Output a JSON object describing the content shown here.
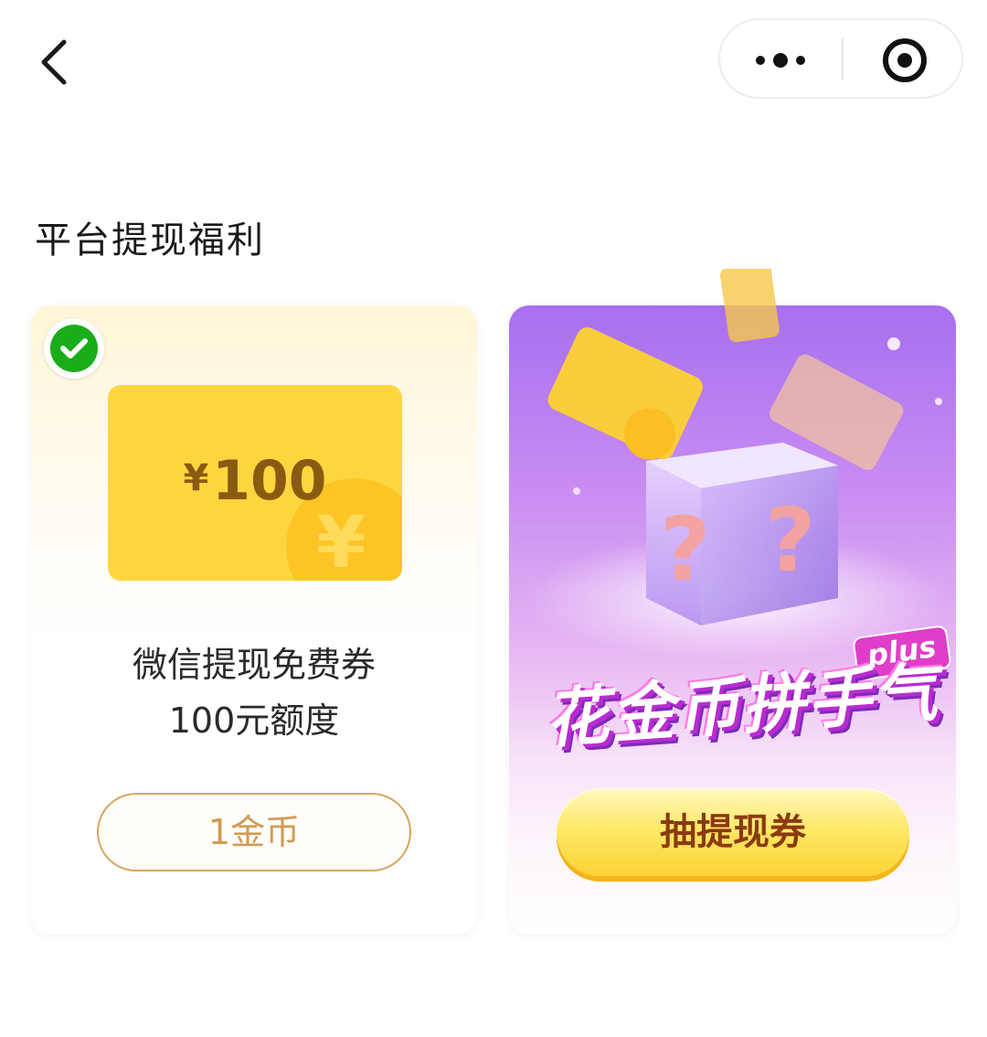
{
  "nav": {
    "back_icon": "chevron-left-icon",
    "more_icon": "more-dots-icon",
    "close_icon": "target-close-icon"
  },
  "section": {
    "title": "平台提现福利"
  },
  "cards": {
    "wechat": {
      "badge_icon": "wechat-pay-icon",
      "voucher_currency": "¥",
      "voucher_amount": "100",
      "coin_glyph": "¥",
      "desc_line1": "微信提现免费券",
      "desc_line2": "100元额度",
      "button_label": "1金币"
    },
    "lucky": {
      "promo_title": "花金币拼手气",
      "plus_tag": "plus",
      "button_label": "抽提现券"
    }
  },
  "colors": {
    "voucher_yellow": "#fdd63f",
    "coin_button_border": "#d6a461",
    "promo_purple": "#a86ff0",
    "draw_button_yellow": "#ffe96a"
  }
}
